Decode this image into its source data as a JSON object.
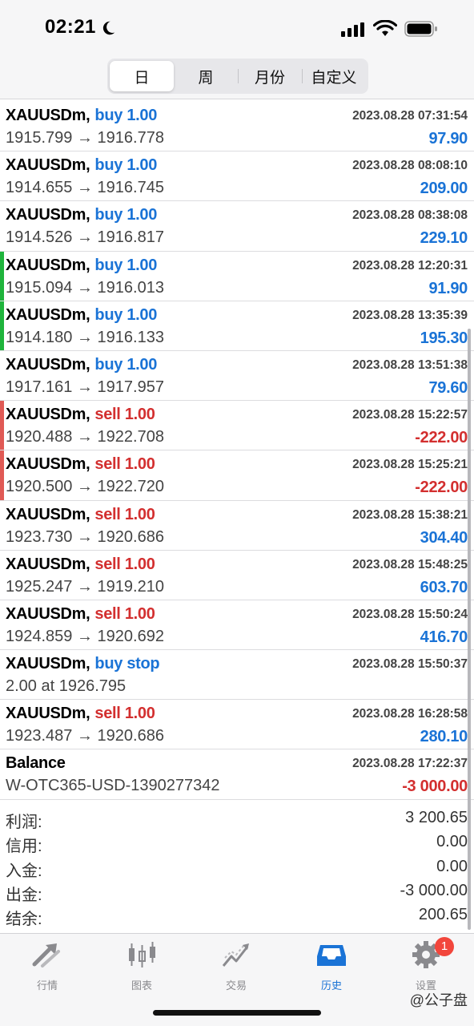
{
  "status_bar": {
    "time": "02:21"
  },
  "segments": [
    {
      "label": "日",
      "active": true
    },
    {
      "label": "周",
      "active": false
    },
    {
      "label": "月份",
      "active": false
    },
    {
      "label": "自定义",
      "active": false
    }
  ],
  "trades": [
    {
      "symbol": "XAUUSDm,",
      "action": "buy 1.00",
      "side": "buy",
      "prices": "1915.799 → 1916.778",
      "datetime": "2023.08.28 07:31:54",
      "profit": "97.90",
      "profit_sign": "pos",
      "bar_color": ""
    },
    {
      "symbol": "XAUUSDm,",
      "action": "buy 1.00",
      "side": "buy",
      "prices": "1914.655 → 1916.745",
      "datetime": "2023.08.28 08:08:10",
      "profit": "209.00",
      "profit_sign": "pos",
      "bar_color": ""
    },
    {
      "symbol": "XAUUSDm,",
      "action": "buy 1.00",
      "side": "buy",
      "prices": "1914.526 → 1916.817",
      "datetime": "2023.08.28 08:38:08",
      "profit": "229.10",
      "profit_sign": "pos",
      "bar_color": ""
    },
    {
      "symbol": "XAUUSDm,",
      "action": "buy 1.00",
      "side": "buy",
      "prices": "1915.094 → 1916.013",
      "datetime": "2023.08.28 12:20:31",
      "profit": "91.90",
      "profit_sign": "pos",
      "bar_color": "#1fb43c"
    },
    {
      "symbol": "XAUUSDm,",
      "action": "buy 1.00",
      "side": "buy",
      "prices": "1914.180 → 1916.133",
      "datetime": "2023.08.28 13:35:39",
      "profit": "195.30",
      "profit_sign": "pos",
      "bar_color": "#1fb43c"
    },
    {
      "symbol": "XAUUSDm,",
      "action": "buy 1.00",
      "side": "buy",
      "prices": "1917.161 → 1917.957",
      "datetime": "2023.08.28 13:51:38",
      "profit": "79.60",
      "profit_sign": "pos",
      "bar_color": ""
    },
    {
      "symbol": "XAUUSDm,",
      "action": "sell 1.00",
      "side": "sell",
      "prices": "1920.488 → 1922.708",
      "datetime": "2023.08.28 15:22:57",
      "profit": "-222.00",
      "profit_sign": "neg",
      "bar_color": "#e05a55"
    },
    {
      "symbol": "XAUUSDm,",
      "action": "sell 1.00",
      "side": "sell",
      "prices": "1920.500 → 1922.720",
      "datetime": "2023.08.28 15:25:21",
      "profit": "-222.00",
      "profit_sign": "neg",
      "bar_color": "#e05a55"
    },
    {
      "symbol": "XAUUSDm,",
      "action": "sell 1.00",
      "side": "sell",
      "prices": "1923.730 → 1920.686",
      "datetime": "2023.08.28 15:38:21",
      "profit": "304.40",
      "profit_sign": "pos",
      "bar_color": ""
    },
    {
      "symbol": "XAUUSDm,",
      "action": "sell 1.00",
      "side": "sell",
      "prices": "1925.247 → 1919.210",
      "datetime": "2023.08.28 15:48:25",
      "profit": "603.70",
      "profit_sign": "pos",
      "bar_color": ""
    },
    {
      "symbol": "XAUUSDm,",
      "action": "sell 1.00",
      "side": "sell",
      "prices": "1924.859 → 1920.692",
      "datetime": "2023.08.28 15:50:24",
      "profit": "416.70",
      "profit_sign": "pos",
      "bar_color": ""
    },
    {
      "symbol": "XAUUSDm,",
      "action": "buy stop",
      "side": "buy",
      "prices": "2.00 at 1926.795",
      "datetime": "2023.08.28 15:50:37",
      "profit": "",
      "profit_sign": "pos",
      "bar_color": ""
    },
    {
      "symbol": "XAUUSDm,",
      "action": "sell 1.00",
      "side": "sell",
      "prices": "1923.487 → 1920.686",
      "datetime": "2023.08.28 16:28:58",
      "profit": "280.10",
      "profit_sign": "pos",
      "bar_color": ""
    },
    {
      "symbol": "Balance",
      "action": "",
      "side": "buy",
      "prices": "W-OTC365-USD-1390277342",
      "datetime": "2023.08.28 17:22:37",
      "profit": "-3 000.00",
      "profit_sign": "neg",
      "bar_color": ""
    }
  ],
  "summary": [
    {
      "label": "利润:",
      "value": "3 200.65"
    },
    {
      "label": "信用:",
      "value": "0.00"
    },
    {
      "label": "入金:",
      "value": "0.00"
    },
    {
      "label": "出金:",
      "value": "-3 000.00"
    },
    {
      "label": "结余:",
      "value": "200.65"
    }
  ],
  "tabs": [
    {
      "label": "行情",
      "icon": "quotes-arrows-icon",
      "active": false
    },
    {
      "label": "图表",
      "icon": "candlestick-chart-icon",
      "active": false
    },
    {
      "label": "交易",
      "icon": "trade-line-icon",
      "active": false
    },
    {
      "label": "历史",
      "icon": "history-inbox-icon",
      "active": true
    },
    {
      "label": "设置",
      "icon": "gear-icon",
      "active": false,
      "badge": "1"
    }
  ],
  "watermark": "@公子盘",
  "colors": {
    "buy": "#1a73d6",
    "sell": "#d32f2f",
    "active_tab": "#1a73d6",
    "inactive_tab": "#8a8a8e",
    "badge": "#f2463c"
  }
}
